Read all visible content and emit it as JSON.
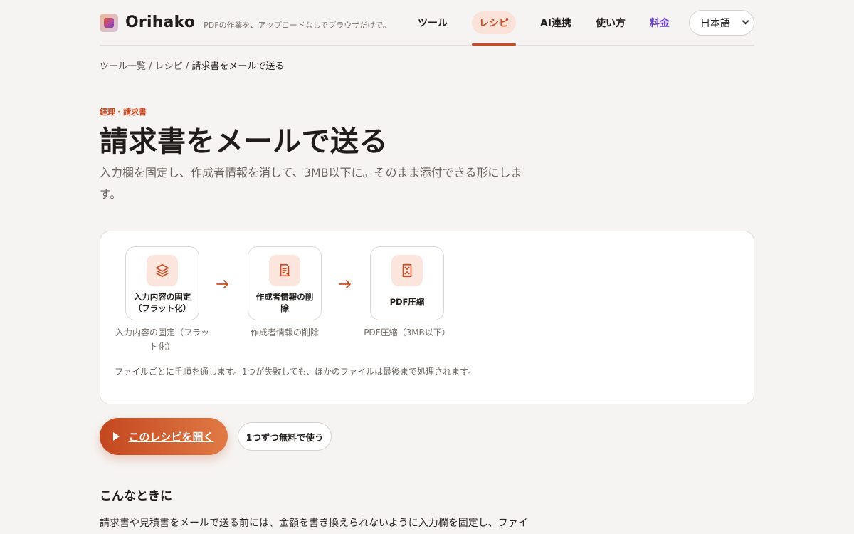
{
  "header": {
    "brand": "Orihako",
    "tagline": "PDFの作業を、アップロードなしでブラウザだけで。",
    "nav": [
      {
        "label": "ツール"
      },
      {
        "label": "レシピ"
      },
      {
        "label": "AI連携"
      },
      {
        "label": "使い方"
      },
      {
        "label": "料金"
      }
    ],
    "language": "日本語",
    "active_nav": "レシピ"
  },
  "breadcrumb": {
    "items": [
      "ツール一覧",
      "レシピ"
    ],
    "separator": "/",
    "current": "請求書をメールで送る"
  },
  "page": {
    "kicker": "経理・請求書",
    "title": "請求書をメールで送る",
    "subtitle": "入力欄を固定し、作成者情報を消して、3MB以下に。そのまま添付できる形にします。"
  },
  "flow": {
    "steps": [
      {
        "title": "入力内容の固定（フラット化）",
        "caption": "入力内容の固定（フラット化）",
        "icon": "layers-icon"
      },
      {
        "title": "作成者情報の削除",
        "caption": "作成者情報の削除",
        "icon": "document-edit-icon"
      },
      {
        "title": "PDF圧縮",
        "caption": "PDF圧縮（3MB以下）",
        "icon": "compress-icon"
      }
    ],
    "note": "ファイルごとに手順を通します。1つが失敗しても、ほかのファイルは最後まで処理されます。"
  },
  "actions": {
    "primary": "このレシピを開く",
    "secondary": "1つずつ無料で使う"
  },
  "section": {
    "heading": "こんなときに",
    "text": "請求書や見積書をメールで送る前には、金額を書き換えられないように入力欄を固定し、ファイ"
  },
  "colors": {
    "accent": "#c94b22",
    "price": "#6a43c9",
    "background": "#f6f4f2"
  }
}
